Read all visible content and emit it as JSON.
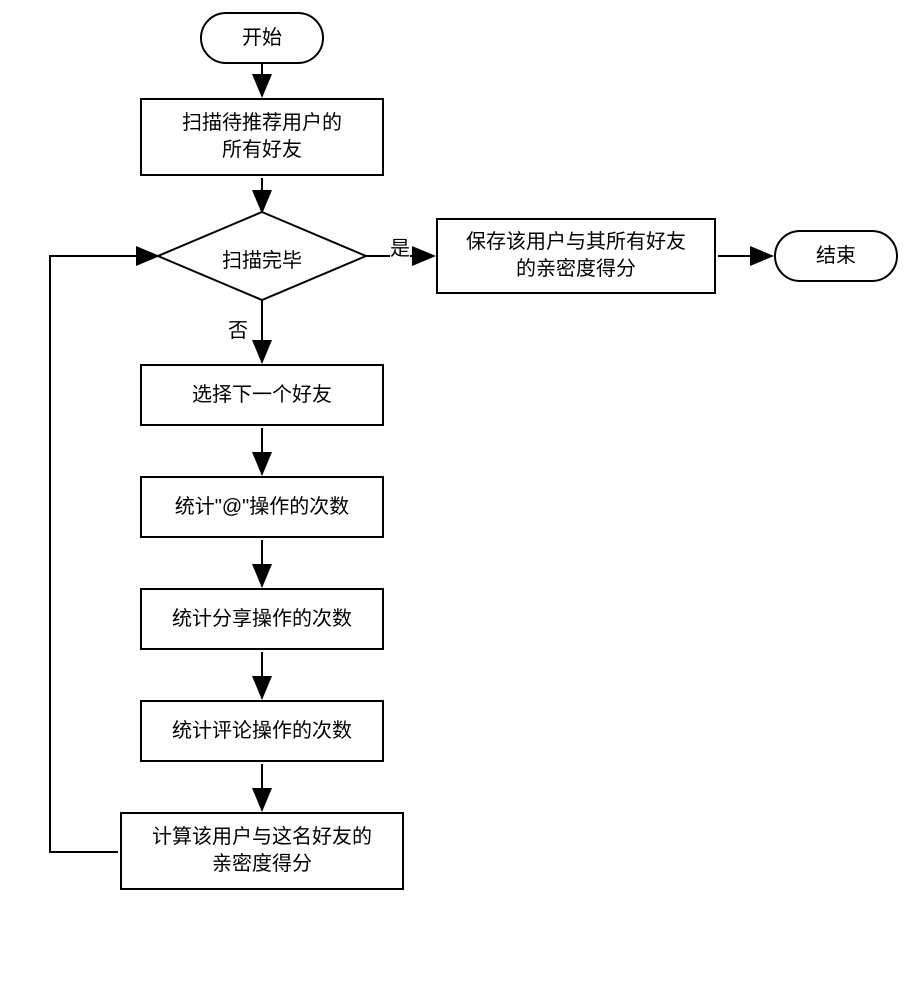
{
  "flowchart": {
    "start": "开始",
    "end": "结束",
    "scan_all_friends_line1": "扫描待推荐用户的",
    "scan_all_friends_line2": "所有好友",
    "decision": "扫描完毕",
    "save_score_line1": "保存该用户与其所有好友",
    "save_score_line2": "的亲密度得分",
    "select_next": "选择下一个好友",
    "count_at": "统计\"@\"操作的次数",
    "count_share": "统计分享操作的次数",
    "count_comment": "统计评论操作的次数",
    "calc_score_line1": "计算该用户与这名好友的",
    "calc_score_line2": "亲密度得分",
    "yes_label": "是",
    "no_label": "否"
  }
}
